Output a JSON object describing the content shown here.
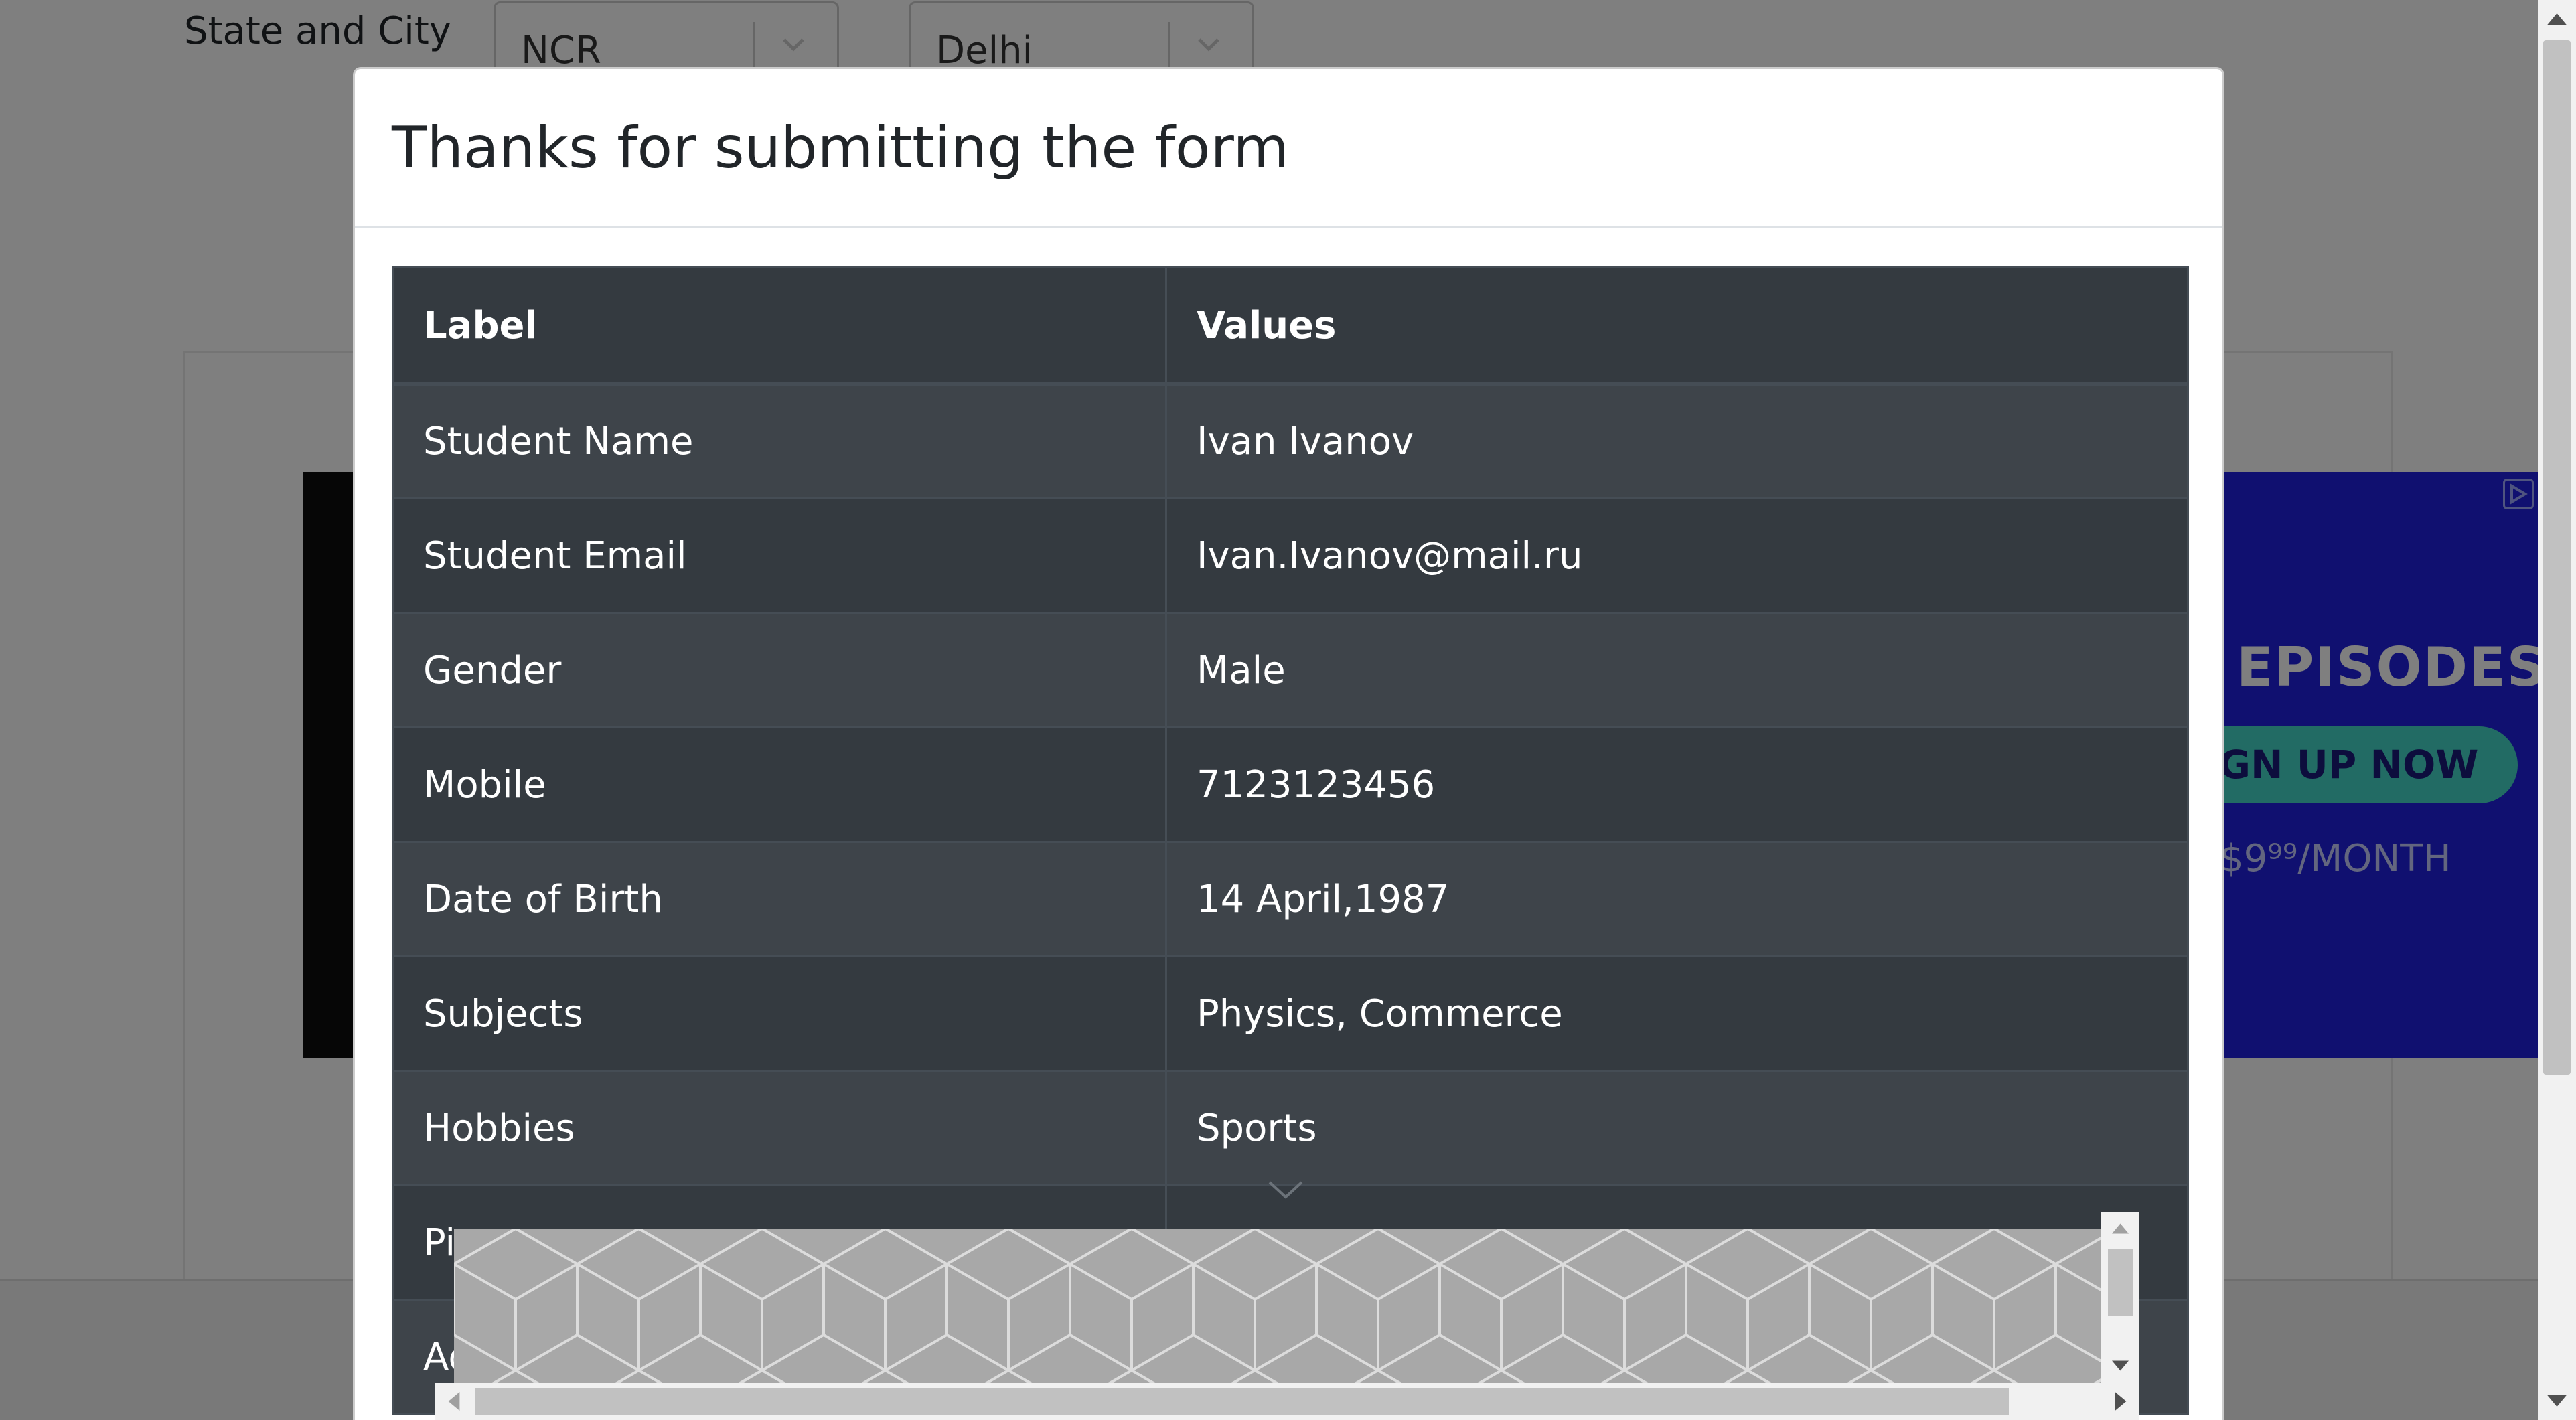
{
  "background_form": {
    "state_city_label": "State and City",
    "state_value": "NCR",
    "city_value": "Delhi"
  },
  "ad": {
    "episodes_text": "EPISODES",
    "signup_text": "SIGN UP NOW",
    "price_text": "$9⁹⁹/MONTH"
  },
  "modal": {
    "title": "Thanks for submitting the form",
    "table": {
      "header_label": "Label",
      "header_values": "Values",
      "rows": [
        {
          "label": "Student Name",
          "value": "Ivan Ivanov"
        },
        {
          "label": "Student Email",
          "value": "Ivan.Ivanov@mail.ru"
        },
        {
          "label": "Gender",
          "value": "Male"
        },
        {
          "label": "Mobile",
          "value": "7123123456"
        },
        {
          "label": "Date of Birth",
          "value": "14 April,1987"
        },
        {
          "label": "Subjects",
          "value": "Physics, Commerce"
        },
        {
          "label": "Hobbies",
          "value": "Sports"
        },
        {
          "label": "Pi",
          "value": ""
        },
        {
          "label": "Ad",
          "value": ""
        }
      ]
    }
  },
  "colors": {
    "overlay": "rgba(0,0,0,0.5)",
    "table_dark": "#343a40",
    "table_stripe": "#3e444a",
    "ad_blue": "#2020e0",
    "ad_teal": "#45d6c8"
  },
  "icons": [
    "chevron-down-icon",
    "ad-choices-icon",
    "scroll-up-arrow-icon",
    "scroll-down-arrow-icon",
    "scroll-left-arrow-icon",
    "scroll-right-arrow-icon"
  ]
}
